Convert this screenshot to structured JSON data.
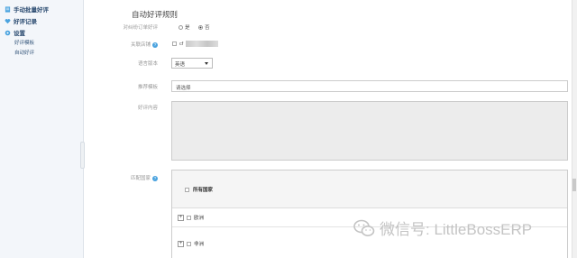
{
  "sidebar": {
    "items": [
      {
        "label": "手动批量好评",
        "icon": "document-icon"
      },
      {
        "label": "好评记录",
        "icon": "heart-icon"
      },
      {
        "label": "设置",
        "icon": "gear-icon"
      }
    ],
    "sub_items": [
      "好评模板",
      "自动好评"
    ]
  },
  "form": {
    "title": "自动好评规则",
    "order_reviewed_label": "对纠纷订单好评",
    "yes_label": "是",
    "no_label": "否",
    "selected": "否",
    "store_label": "关联店铺",
    "store_value": "cf",
    "language_label": "语言版本",
    "language_value": "英语",
    "template_label": "推荐模板",
    "template_value": "请选择",
    "content_label": "好评内容",
    "content_value": "",
    "country_label": "匹配国家",
    "all_countries": "所有国家",
    "regions": [
      "欧洲",
      "非洲"
    ]
  },
  "watermark": {
    "text": "微信号: LittleBossERP"
  },
  "colors": {
    "accent": "#4aa3df",
    "sidebar_bg": "#f3f6fa",
    "sidebar_text": "#2d4d72"
  }
}
